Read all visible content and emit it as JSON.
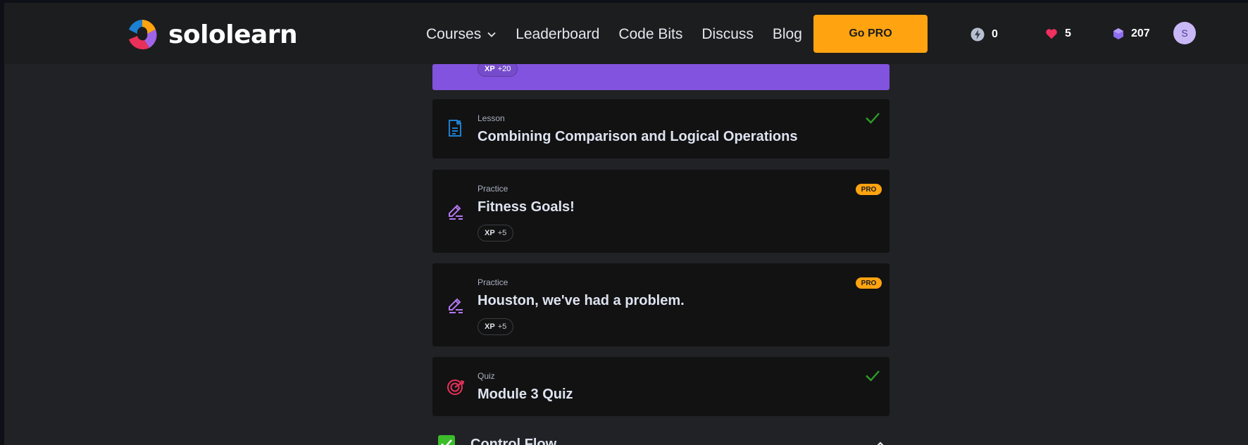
{
  "brand": {
    "name": "sololearn"
  },
  "nav": {
    "items": [
      {
        "label": "Courses",
        "has_dropdown": true
      },
      {
        "label": "Leaderboard"
      },
      {
        "label": "Code Bits"
      },
      {
        "label": "Discuss"
      },
      {
        "label": "Blog"
      }
    ],
    "go_pro_label": "Go PRO"
  },
  "stats": {
    "streak": "0",
    "hearts": "5",
    "bits": "207",
    "avatar_initial": "S"
  },
  "top_card": {
    "xp_label": "XP",
    "xp_value": "+20",
    "color": "#8153de"
  },
  "items": [
    {
      "type": "Lesson",
      "title": "Combining Comparison and Logical Operations",
      "completed": true,
      "icon": "lesson-icon"
    },
    {
      "type": "Practice",
      "title": "Fitness Goals!",
      "pro": "PRO",
      "xp_label": "XP",
      "xp_value": "+5",
      "icon": "pencil-icon"
    },
    {
      "type": "Practice",
      "title": "Houston, we've had a problem.",
      "pro": "PRO",
      "xp_label": "XP",
      "xp_value": "+5",
      "icon": "pencil-icon"
    },
    {
      "type": "Quiz",
      "title": "Module 3 Quiz",
      "completed": true,
      "icon": "target-icon"
    }
  ],
  "next_section": {
    "title": "Control Flow",
    "completed": true
  },
  "colors": {
    "accent_orange": "#ffa310",
    "check_green": "#2f9c2a",
    "purple": "#8153de",
    "lesson_blue": "#1d7fd1",
    "quiz_red": "#e8305a"
  }
}
